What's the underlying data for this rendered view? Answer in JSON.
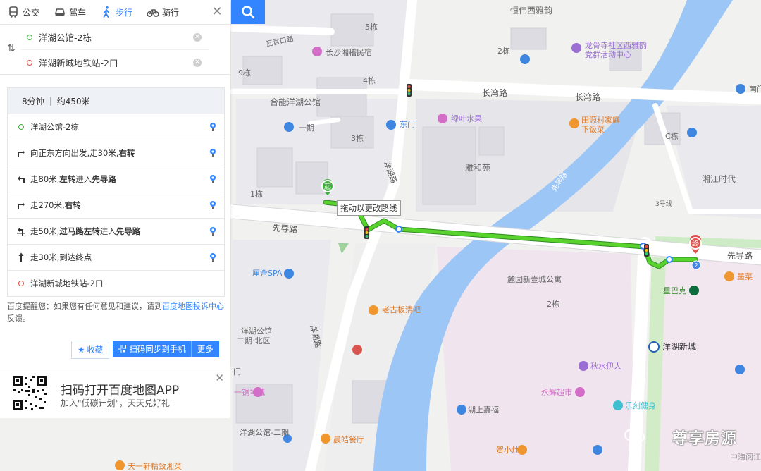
{
  "modes": [
    {
      "label": "公交",
      "icon": "bus-icon"
    },
    {
      "label": "驾车",
      "icon": "car-icon"
    },
    {
      "label": "步行",
      "icon": "walk-icon",
      "active": true
    },
    {
      "label": "骑行",
      "icon": "bike-icon"
    }
  ],
  "route": {
    "start": "洋湖公馆-2栋",
    "end": "洋湖新城地铁站-2口"
  },
  "summary": {
    "time": "8分钟",
    "distance": "约450米"
  },
  "steps": [
    {
      "pre": "洋湖公馆-2栋",
      "bold": "",
      "post": "",
      "icon": "start-dot-icon"
    },
    {
      "pre": "向正东方向出发,走30米,",
      "bold": "右转",
      "post": "",
      "icon": "turn-right-icon"
    },
    {
      "pre": "走80米,",
      "bold": "左转",
      "mid": "进入",
      "bold2": "先导路",
      "icon": "turn-left-icon"
    },
    {
      "pre": "走270米,",
      "bold": "右转",
      "post": "",
      "icon": "turn-right-icon"
    },
    {
      "pre": "走50米,",
      "bold": "过马路左转",
      "mid": "进入",
      "bold2": "先导路",
      "icon": "cross-left-icon"
    },
    {
      "pre": "走30米,到达终点",
      "bold": "",
      "post": "",
      "icon": "straight-icon"
    },
    {
      "pre": "洋湖新城地铁站-2口",
      "bold": "",
      "post": "",
      "icon": "end-dot-icon"
    }
  ],
  "tip": {
    "pre": "百度提醒您：如果您有任何意见和建议，请到",
    "link": "百度地图投诉中心",
    "post": "反馈。"
  },
  "buttons": {
    "fav": "收藏",
    "scan": "扫码同步到手机",
    "more": "更多"
  },
  "app": {
    "title": "扫码打开百度地图APP",
    "sub": "加入\"低碳计划\"，天天兑好礼"
  },
  "tooltip": "拖动以更改路线",
  "markers": {
    "start": "起",
    "end": "终",
    "end_badge": "2"
  },
  "colors": {
    "accent": "#3385ff",
    "route": "#5ad22e",
    "water": "#9cc6f6",
    "road": "#ffffff",
    "block": "#e6e6ea",
    "green": "#cdebc5"
  },
  "map_labels": [
    "恒伟西雅韵",
    "5栋",
    "瓦官口路",
    "长沙湘稽民宿",
    "2栋",
    "龙骨寺社区西雅韵",
    "党群活动中心",
    "9栋",
    "4栋",
    "长湾路",
    "长湾路",
    "南门",
    "合能洋湖公馆",
    "一期",
    "3栋",
    "绿叶水果",
    "东门",
    "田源村家庭",
    "下饭菜",
    "C栋",
    "雅和苑",
    "洋湖路",
    "湘江时代",
    "1栋",
    "3号线",
    "先导路",
    "先导路",
    "先导路",
    "厘舍SPA",
    "麓园新壹城公寓",
    "2栋",
    "老古板清吧",
    "墨菜",
    "星巴克",
    "洋湖公馆",
    "二期·北区",
    "洋湖新城",
    "洋湖路",
    "秋水伊人",
    "门",
    "一铜琴城",
    "永辉超市",
    "乐刻健身",
    "湖上嘉福",
    "洋湖公馆-二期",
    "晨皓餐厅",
    "贺小灶",
    "天一轩精致湘菜"
  ],
  "watermark": "尊享房源",
  "map_source": "中海阅江"
}
